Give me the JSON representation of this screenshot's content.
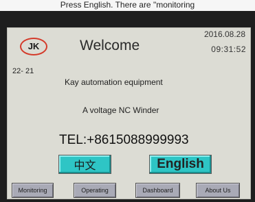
{
  "caption": "Press English. There are \"monitoring",
  "header": {
    "logo": "JK",
    "welcome": "Welcome",
    "date": "2016.08.28",
    "time": "09:31:52"
  },
  "info": {
    "code": "22- 21",
    "company": "Kay automation equipment",
    "product": "A voltage NC Winder",
    "tel": "TEL:+8615088999993"
  },
  "language": {
    "chinese_label": "中文",
    "english_label": "English"
  },
  "nav": {
    "monitoring": "Monitoring",
    "operating": "Operating",
    "dashboard": "Dashboard",
    "about": "About Us"
  },
  "colors": {
    "screen_bg": "#dcdcd4",
    "logo_ring": "#d43a2a",
    "lang_button": "#2ec5c5",
    "nav_button": "#a9aab6"
  }
}
